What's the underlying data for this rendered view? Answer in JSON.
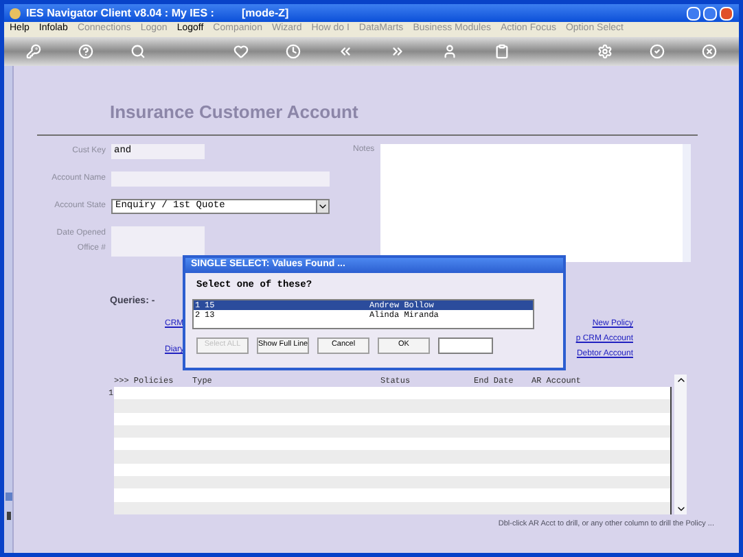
{
  "window": {
    "title": "IES Navigator Client v8.04 : My IES :",
    "mode": "[mode-Z]"
  },
  "menu": [
    {
      "label": "Help",
      "disabled": false
    },
    {
      "label": "Infolab",
      "disabled": false
    },
    {
      "label": "Connections",
      "disabled": true
    },
    {
      "label": "Logon",
      "disabled": true
    },
    {
      "label": "Logoff",
      "disabled": false
    },
    {
      "label": "Companion",
      "disabled": true
    },
    {
      "label": "Wizard",
      "disabled": true
    },
    {
      "label": "How do I",
      "disabled": true
    },
    {
      "label": "DataMarts",
      "disabled": true
    },
    {
      "label": "Business Modules",
      "disabled": true
    },
    {
      "label": "Action Focus",
      "disabled": true
    },
    {
      "label": "Option Select",
      "disabled": true
    }
  ],
  "form": {
    "title": "Insurance Customer Account",
    "fields": [
      {
        "kind": "text",
        "label": "Cust Key",
        "value": "and"
      },
      {
        "kind": "wide",
        "label": "Account Name"
      },
      {
        "kind": "select",
        "label": "Account State",
        "value": "Enquiry / 1st Quote"
      },
      {
        "kind": "text",
        "label": "Date Opened"
      },
      {
        "kind": "text",
        "label": "Office #"
      }
    ],
    "notes_label": "Notes"
  },
  "queries": {
    "label": "Queries: -",
    "left_links": [
      "CRM",
      "Diary"
    ],
    "right_links": [
      "New Policy",
      "p CRM Account",
      "Debtor Account"
    ]
  },
  "table": {
    "columns": [
      ">>> Policies",
      "Type",
      "Status",
      "End Date",
      "AR Account"
    ],
    "row_number": "1"
  },
  "status_hint": "Dbl-click AR Acct to drill, or any other column to drill the Policy ...",
  "dialog": {
    "title": "SINGLE SELECT: Values Found ...",
    "prompt": "Select one of these?",
    "rows": [
      {
        "index": "1",
        "code": "15",
        "name": "Andrew Bollow",
        "selected": true
      },
      {
        "index": "2",
        "code": "13",
        "name": "Alinda Miranda",
        "selected": false
      }
    ],
    "buttons": [
      {
        "label": "Select ALL",
        "disabled": true
      },
      {
        "label": "Show Full Line",
        "disabled": false
      },
      {
        "label": "Cancel",
        "disabled": false
      },
      {
        "label": "OK",
        "disabled": false
      }
    ]
  }
}
